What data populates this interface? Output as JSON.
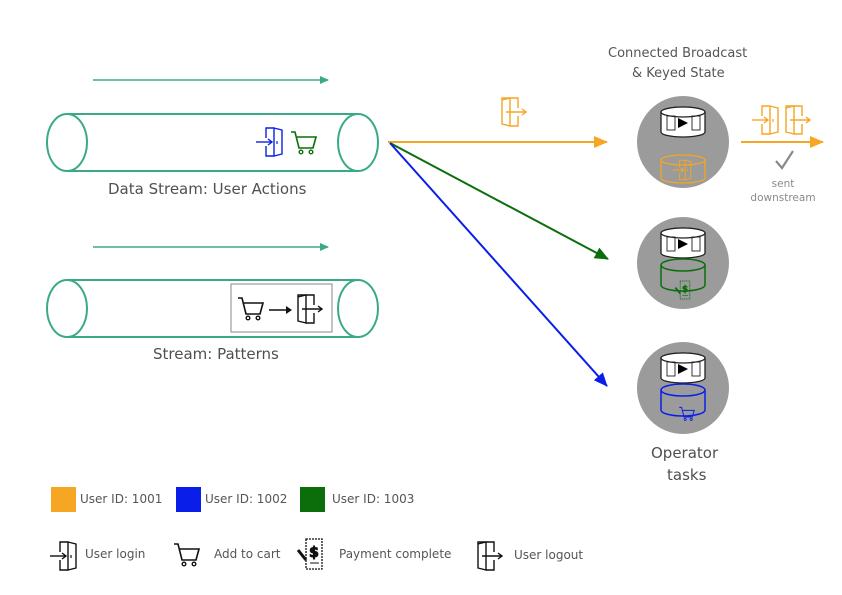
{
  "colors": {
    "stream": "#3aaa86",
    "user_1001": "#f5a623",
    "user_1002": "#0a1eea",
    "user_1003": "#0b6e0b",
    "operator_circle": "#9b9b9b",
    "check": "#8a8a8a"
  },
  "streams": [
    {
      "label": "Data Stream: User Actions",
      "events": [
        "user-login",
        "add-to-cart"
      ]
    },
    {
      "label": "Stream: Patterns",
      "pattern": [
        "add-to-cart",
        "user-logout"
      ]
    }
  ],
  "operator": {
    "header": [
      "Connected Broadcast",
      "& Keyed State"
    ],
    "footer": [
      "Operator",
      "tasks"
    ],
    "tasks": [
      {
        "user": "1001",
        "state_icon": "user-login"
      },
      {
        "user": "1003",
        "state_icon": "payment-complete"
      },
      {
        "user": "1002",
        "state_icon": "add-to-cart"
      }
    ]
  },
  "routing": {
    "incoming_event_icon": "user-logout",
    "output_events": [
      "user-login",
      "user-logout"
    ],
    "output_status": [
      "sent",
      "downstream"
    ]
  },
  "legend": {
    "users": [
      {
        "label": "User ID: 1001",
        "color": "#f5a623"
      },
      {
        "label": "User ID: 1002",
        "color": "#0a1eea"
      },
      {
        "label": "User ID: 1003",
        "color": "#0b6e0b"
      }
    ],
    "events": [
      {
        "icon": "user-login",
        "label": "User login"
      },
      {
        "icon": "add-to-cart",
        "label": "Add to cart"
      },
      {
        "icon": "payment-complete",
        "label": "Payment complete"
      },
      {
        "icon": "user-logout",
        "label": "User logout"
      }
    ]
  }
}
